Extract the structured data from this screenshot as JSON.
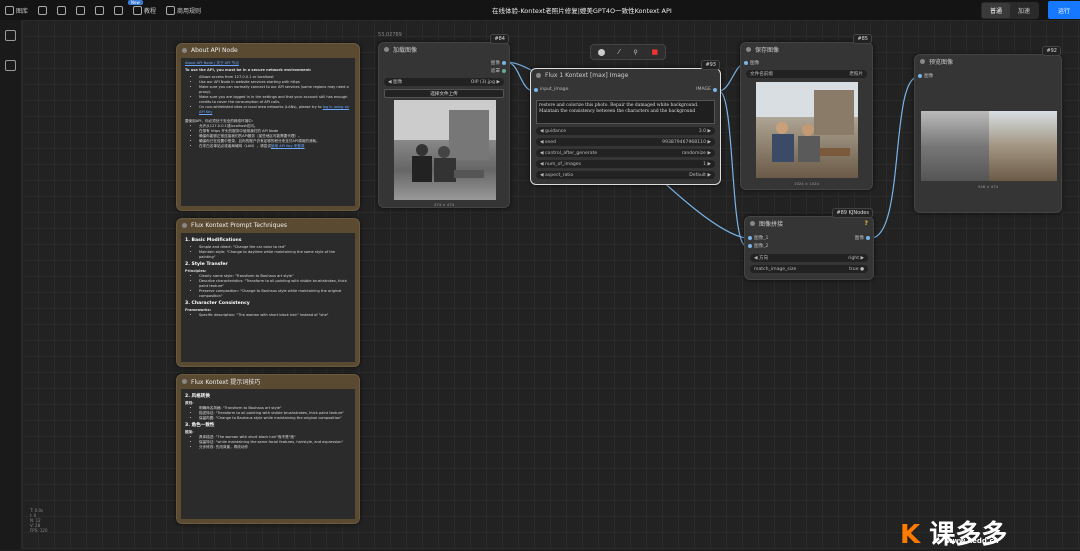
{
  "topbar": {
    "items": [
      "图库",
      "",
      "",
      "",
      "",
      "",
      "教程",
      "商用规则"
    ],
    "new_badge": "New",
    "title": "在线体验-Kontext老照片修复|媲美GPT4O一致性Kontext API",
    "modes": [
      "普通",
      "加速"
    ],
    "run": "运行"
  },
  "stats": [
    "T: 0.0s",
    "I: 0",
    "N: 12",
    "V: 28",
    "FPS: 120",
    "@ 100%"
  ],
  "nodes": {
    "about_api": {
      "title": "About API Node",
      "link1": "About API Node | 关于 API 节点",
      "intro": "To use the API, you must be in a secure network environment:",
      "bullets": [
        "Allows access from 127.0.0.1 or localhost",
        "Use our API Node in website services starting with https",
        "Make sure you can normally connect to our API services (some regions may need a proxy).",
        "Make sure you are logged in in the settings and that your account still has enough credits to cover the consumption of API calls.",
        "On non-whitelisted sites or local area networks (LANs), please try to"
      ],
      "link2": "log in using an API Key",
      "cn_intro": "要使用API，你必须处于安全的网络环境中：",
      "cn_bullets": [
        "允许从127.0.0.1或localhost访问。",
        "在带有 https 开头的服务中使用我们的 API Node",
        "确保你能够正常连接我们的API服务（某些地区可能需要代理）。",
        "确保你已在设置中登录，且你的账户仍有足够的积分来支付API调用的消耗。",
        "在非白名单站点或者局域网（LAN），请尝试"
      ],
      "cn_link": "使用 API Key 来登录"
    },
    "prompt_tech": {
      "title": "Flux Kontext Prompt Techniques",
      "h1": "1. Basic Modifications",
      "b1": [
        "Simple and direct: \"Change the car color to red\"",
        "Maintain style: \"Change to daytime while maintaining the same style of the painting\""
      ],
      "h2": "2. Style Transfer",
      "principles": "Principles:",
      "b2": [
        "Clearly name style: \"Transform to Bauhaus art style\"",
        "Describe characteristics: \"Transform to oil painting with visible brushstrokes, thick paint texture\"",
        "Preserve composition: \"Change to Bauhaus style while maintaining the original composition\""
      ],
      "h3": "3. Character Consistency",
      "frameworks": "Frameworks:",
      "b3": [
        "Specific description: \"The woman with short black hair\" instead of \"she\""
      ]
    },
    "prompt_cn": {
      "title": "Flux Kontext 提示词技巧",
      "h2": "2. 风格转换",
      "yuanze": "原则:",
      "b2": [
        "明确命名风格: \"Transform to Bauhaus art style\"",
        "描述特征: \"Transform to oil painting with visible brushstrokes, thick paint texture\"",
        "保留构图: \"Change to Bauhaus style while maintaining the original composition\""
      ],
      "h3": "3. 角色一致性",
      "kuangjia": "框架:",
      "b3": [
        "具体描述: \"The woman with short black hair\"而不是\"她\"",
        "保留特征: \"while maintaining the same facial features, hairstyle, and expression\"",
        "分步修改: 先改背景，再改动作"
      ]
    },
    "load_image": {
      "title": "加载图像",
      "id": "#84",
      "pos": "53,02789",
      "out1": "图像",
      "out2": "遮罩",
      "image_label": "图像",
      "image_value": "OIP (3).jpg",
      "upload": "选择文件上传",
      "size": "474 × 474"
    },
    "flux": {
      "title": "Flux 1 Kontext [max] Image",
      "id": "#93",
      "in": "input_image",
      "out": "IMAGE",
      "prompt": "restore and colorize this photo. Repair the damaged white background. Maintain the consistency between the characters and the background",
      "widgets": [
        {
          "label": "guidance",
          "value": "3.0"
        },
        {
          "label": "seed",
          "value": "993879467968110"
        },
        {
          "label": "control_after_generate",
          "value": "randomize"
        },
        {
          "label": "num_of_images",
          "value": "1"
        },
        {
          "label": "aspect_ratio",
          "value": "Default"
        }
      ]
    },
    "save": {
      "title": "保存图像",
      "id": "#85",
      "in": "图像",
      "prefix_label": "文件名前缀",
      "prefix_value": "老照片",
      "size": "1024 × 1024"
    },
    "preview": {
      "title": "预览图像",
      "id": "#92",
      "in": "图像",
      "size": "948 × 474"
    },
    "stitch": {
      "title": "图像拼接",
      "id": "#89 KJNodes",
      "in1": "图像_1",
      "in2": "图像_2",
      "out": "图像",
      "dir_label": "方向",
      "dir_value": "right",
      "match_label": "match_image_size",
      "match_value": "true",
      "help": "?"
    }
  },
  "watermark": {
    "brand": "课多多",
    "url": "www.kedd.cn"
  }
}
